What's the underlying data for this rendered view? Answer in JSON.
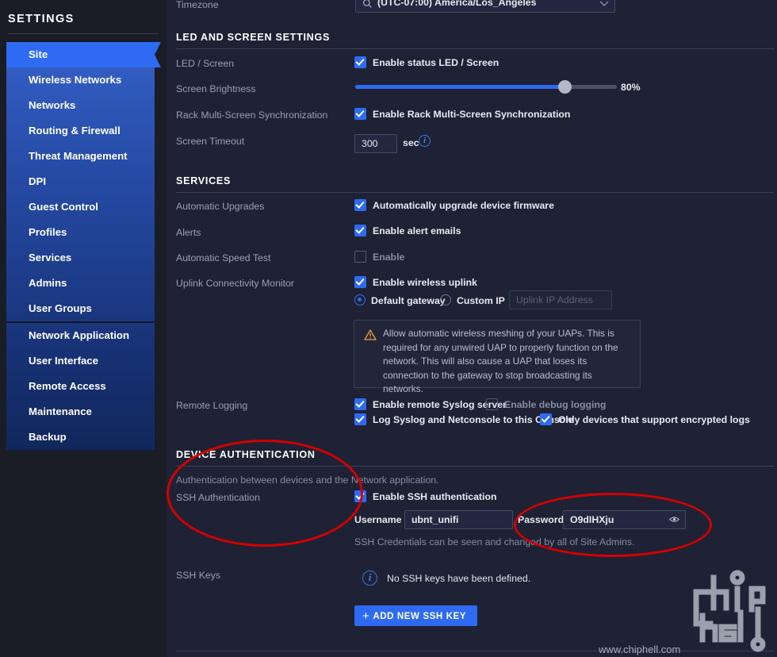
{
  "sidebar": {
    "title": "SETTINGS",
    "items": [
      {
        "label": "Site",
        "active": true
      },
      {
        "label": "Wireless Networks",
        "active": false
      },
      {
        "label": "Networks",
        "active": false
      },
      {
        "label": "Routing & Firewall",
        "active": false
      },
      {
        "label": "Threat Management",
        "active": false
      },
      {
        "label": "DPI",
        "active": false
      },
      {
        "label": "Guest Control",
        "active": false
      },
      {
        "label": "Profiles",
        "active": false
      },
      {
        "label": "Services",
        "active": false
      },
      {
        "label": "Admins",
        "active": false
      },
      {
        "label": "User Groups",
        "active": false
      },
      {
        "label": "Network Application",
        "active": false
      },
      {
        "label": "User Interface",
        "active": false
      },
      {
        "label": "Remote Access",
        "active": false
      },
      {
        "label": "Maintenance",
        "active": false
      },
      {
        "label": "Backup",
        "active": false
      }
    ]
  },
  "timezone": {
    "label": "Timezone",
    "value": "(UTC-07:00) America/Los_Angeles",
    "search_icon": "search-icon",
    "chevron_icon": "chevron-down-icon"
  },
  "led_screen": {
    "section_title": "LED AND SCREEN SETTINGS",
    "led_label": "LED / Screen",
    "led_checkbox_label": "Enable status LED / Screen",
    "led_checked": true,
    "brightness_label": "Screen Brightness",
    "brightness_value": "80%",
    "brightness_percent": 80,
    "rack_label": "Rack Multi-Screen Synchronization",
    "rack_checkbox_label": "Enable Rack Multi-Screen Synchronization",
    "rack_checked": true,
    "timeout_label": "Screen Timeout",
    "timeout_value": "300",
    "timeout_unit": "sec",
    "timeout_info_icon": "info-icon"
  },
  "services": {
    "section_title": "SERVICES",
    "auto_upgrades_label": "Automatic Upgrades",
    "auto_upgrades_checkbox": "Automatically upgrade device firmware",
    "auto_upgrades_checked": true,
    "alerts_label": "Alerts",
    "alerts_checkbox": "Enable alert emails",
    "alerts_checked": true,
    "speedtest_label": "Automatic Speed Test",
    "speedtest_checkbox": "Enable",
    "speedtest_checked": false,
    "uplink_label": "Uplink Connectivity Monitor",
    "uplink_checkbox": "Enable wireless uplink",
    "uplink_checked": true,
    "radio_default": "Default gateway",
    "radio_custom": "Custom IP",
    "radio_selected": "Default gateway",
    "uplink_ip_placeholder": "Uplink IP Address",
    "uplink_ip_value": "",
    "warning_icon": "warning-triangle-icon",
    "warning_text": "Allow automatic wireless meshing of your UAPs. This is required for any unwired UAP to properly function on the network. This will also cause a UAP that loses its connection to the gateway to stop broadcasting its networks.",
    "remote_logging_label": "Remote Logging",
    "syslog_checkbox": "Enable remote Syslog server",
    "syslog_checked": true,
    "debug_checkbox": "Enable debug logging",
    "debug_checked": false,
    "netconsole_checkbox": "Log Syslog and Netconsole to this Console",
    "netconsole_checked": true,
    "encrypted_checkbox": "Only devices that support encrypted logs",
    "encrypted_checked": true
  },
  "device_auth": {
    "section_title": "DEVICE AUTHENTICATION",
    "description": "Authentication between devices and the Network application.",
    "ssh_auth_label": "SSH Authentication",
    "ssh_auth_checkbox": "Enable SSH authentication",
    "ssh_auth_checked": true,
    "username_label": "Username",
    "username_value": "ubnt_unifi",
    "password_label": "Password",
    "password_value": "O9dIHXju",
    "password_reveal_icon": "eye-icon",
    "credentials_note": "SSH Credentials can be seen and changed by all of Site Admins.",
    "ssh_keys_label": "SSH Keys",
    "ssh_keys_info_icon": "info-icon",
    "ssh_keys_empty": "No SSH keys have been defined.",
    "add_key_button": "ADD NEW SSH KEY",
    "add_key_plus_icon": "plus-icon"
  },
  "watermark": {
    "url": "www.chiphell.com",
    "logo_icon": "chiphell-logo-icon"
  },
  "annotations": {
    "left_ellipse": "device-authentication-highlight",
    "right_ellipse": "ssh-password-highlight",
    "color": "#d40000"
  },
  "colors": {
    "accent": "#2f6bf2",
    "background": "#1e2234",
    "sidebar_bg": "#1a1c26",
    "warning": "#e8a33d",
    "annotation": "#d40000"
  }
}
